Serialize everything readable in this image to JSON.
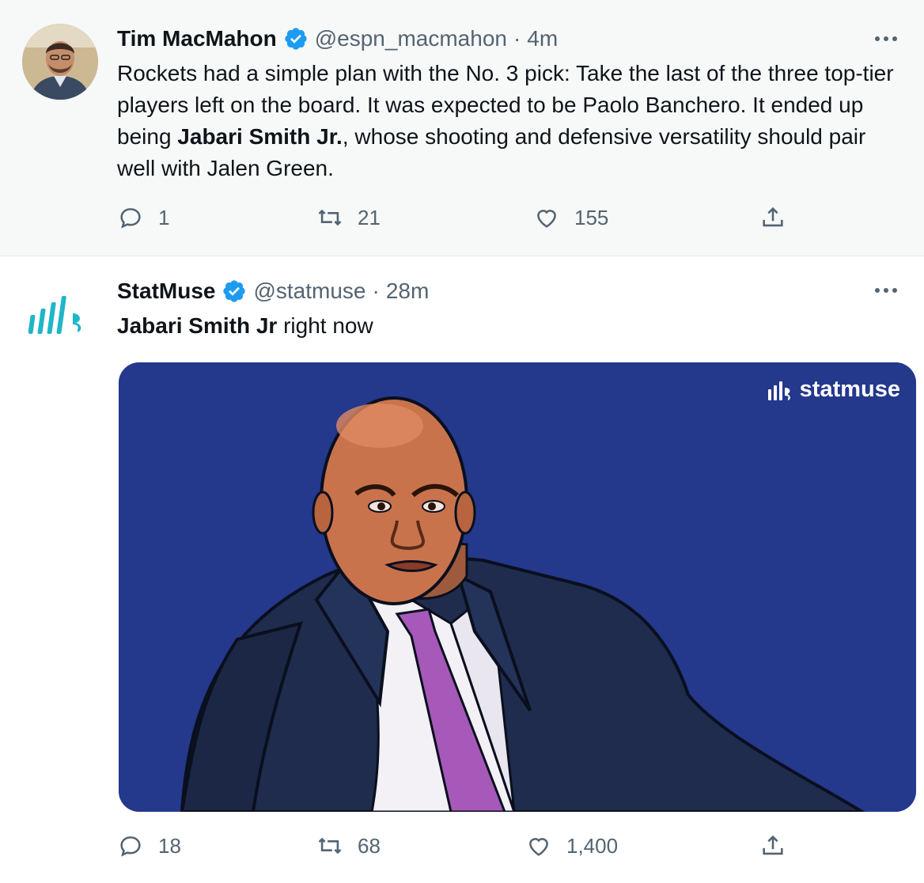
{
  "tweets": [
    {
      "author_name": "Tim MacMahon",
      "handle": "@espn_macmahon",
      "separator": "·",
      "time": "4m",
      "text_before": "Rockets had a simple plan with the No. 3 pick: Take the last of the three top-tier players left on the board. It was expected to be Paolo Banchero. It ended up being ",
      "text_bold": "Jabari Smith Jr.",
      "text_after": ", whose shooting and defensive versatility should pair well with Jalen Green.",
      "replies": "1",
      "retweets": "21",
      "likes": "155"
    },
    {
      "author_name": "StatMuse",
      "handle": "@statmuse",
      "separator": "·",
      "time": "28m",
      "text_bold": "Jabari Smith Jr",
      "text_after": " right now",
      "media_brand": "statmuse",
      "replies": "18",
      "retweets": "68",
      "likes": "1,400"
    }
  ],
  "colors": {
    "verified": "#1d9bf0",
    "muted_text": "#536471",
    "media_background": "#24388c",
    "statmuse_logo": "#1fb6c9"
  },
  "icons": [
    "verified-badge-icon",
    "more-icon",
    "reply-icon",
    "retweet-icon",
    "like-icon",
    "share-icon",
    "statmuse-logo-icon"
  ]
}
